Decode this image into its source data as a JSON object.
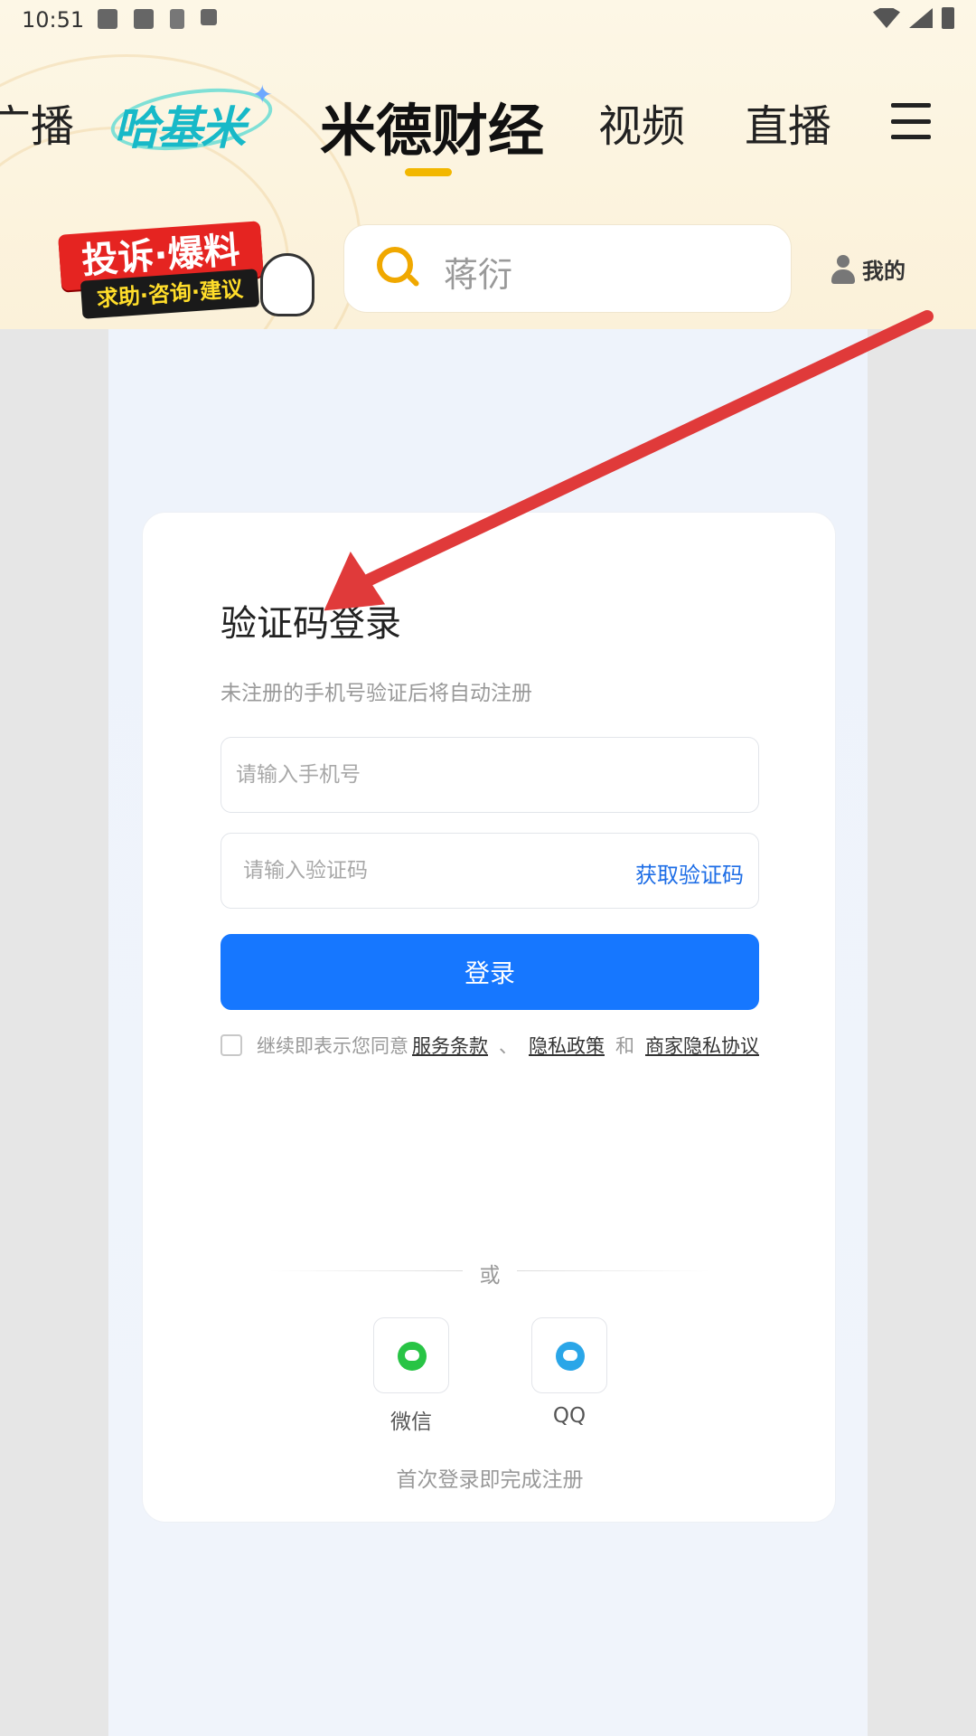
{
  "status_bar": {
    "time": "10:51"
  },
  "nav": {
    "cut_item": "广播",
    "logo_text": "哈基米",
    "active": "米德财经",
    "video": "视频",
    "live": "直播"
  },
  "promo": {
    "top": "投诉·爆料",
    "bottom": "求助·咨询·建议"
  },
  "search": {
    "text": "蒋衍"
  },
  "mine": {
    "label": "我的"
  },
  "login": {
    "title": "验证码登录",
    "subtitle": "未注册的手机号验证后将自动注册",
    "phone_placeholder": "请输入手机号",
    "code_placeholder": "请输入验证码",
    "get_code": "获取验证码",
    "login_button": "登录",
    "agree_prefix": "继续即表示您同意",
    "terms": "服务条款",
    "sep": "、",
    "privacy": "隐私政策",
    "and": "和",
    "merchant_privacy": "商家隐私协议",
    "or": "或",
    "wechat": "微信",
    "qq": "QQ",
    "footer": "首次登录即完成注册"
  },
  "colors": {
    "accent": "#1677ff",
    "link": "#1d6de6",
    "underline": "#f2b700",
    "annotation": "#e03a3a"
  }
}
